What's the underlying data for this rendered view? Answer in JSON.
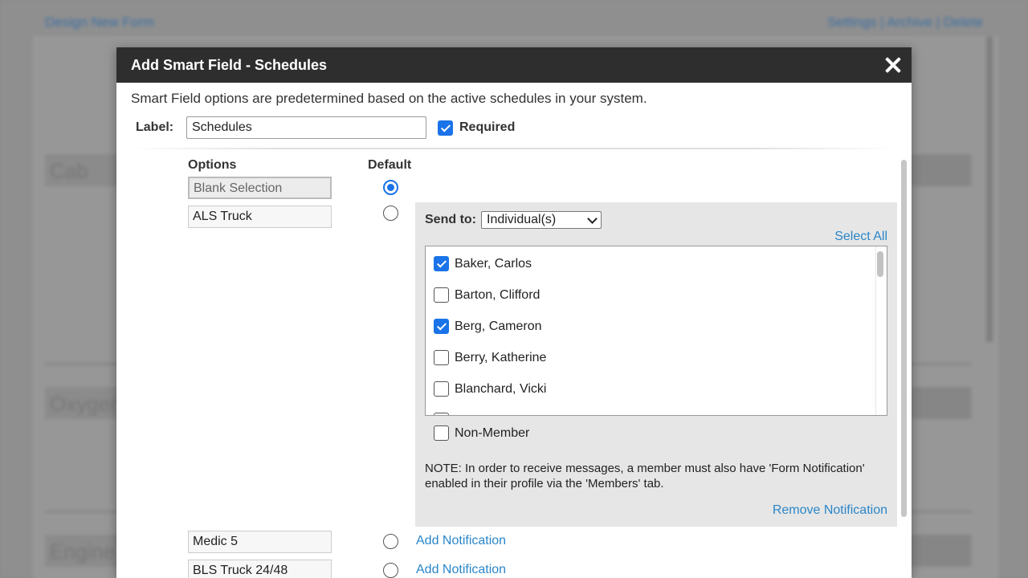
{
  "background": {
    "top_left_link": "Design New Form",
    "top_right_links": "Settings | Archive | Delete",
    "cards": [
      {
        "title": "Cab"
      },
      {
        "title": "Oxygen"
      },
      {
        "title": "Engine"
      }
    ]
  },
  "modal": {
    "title": "Add Smart Field - Schedules",
    "intro": "Smart Field options are predetermined based on the active schedules in your system.",
    "label_caption": "Label:",
    "label_value": "Schedules",
    "required_label": "Required",
    "required_checked": true,
    "columns": {
      "options": "Options",
      "default": "Default"
    },
    "options": [
      {
        "name": "Blank Selection",
        "default": true
      },
      {
        "name": "ALS Truck",
        "default": false
      },
      {
        "name": "Medic 5",
        "default": false,
        "action": "Add Notification"
      },
      {
        "name": "BLS Truck 24/48",
        "default": false,
        "action": "Add Notification"
      }
    ],
    "notification": {
      "send_to_label": "Send to:",
      "send_to_value": "Individual(s)",
      "select_all": "Select All",
      "members": [
        {
          "name": "Baker, Carlos",
          "checked": true
        },
        {
          "name": "Barton, Clifford",
          "checked": false
        },
        {
          "name": "Berg, Cameron",
          "checked": true
        },
        {
          "name": "Berry, Katherine",
          "checked": false
        },
        {
          "name": "Blanchard, Vicki",
          "checked": false
        }
      ],
      "non_member": "Non-Member",
      "note": "NOTE: In order to receive messages, a member must also have 'Form Notification' enabled in their profile via the 'Members' tab.",
      "remove": "Remove Notification"
    }
  },
  "colors": {
    "accent": "#1a73e8",
    "link": "#2a86c8",
    "header_bg": "#2e2e2e",
    "panel_bg": "#e6e6e6"
  }
}
